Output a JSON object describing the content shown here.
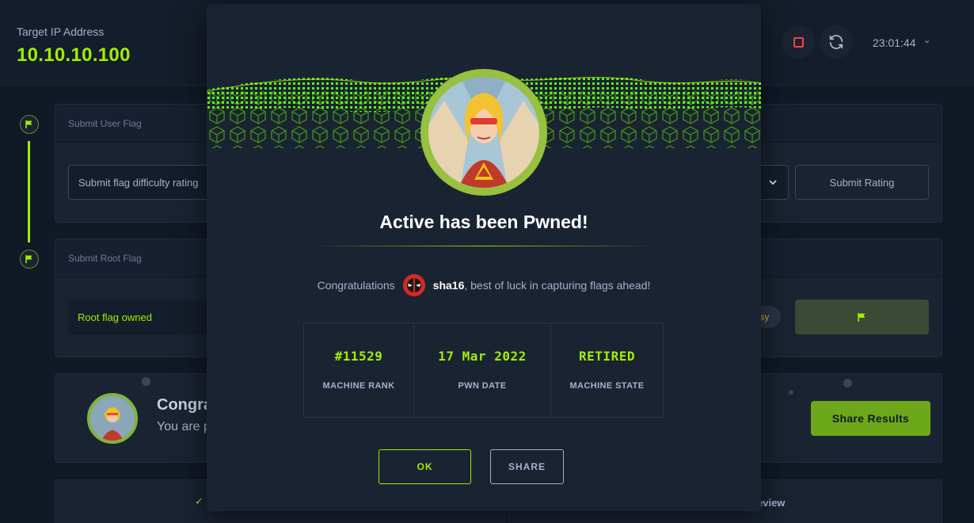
{
  "target": {
    "label": "Target IP Address",
    "ip": "10.10.10.100"
  },
  "controls": {
    "timer": "23:01:44",
    "stop_icon": "stop-icon",
    "reset_icon": "reset-icon"
  },
  "user_flag_card": {
    "title": "Submit User Flag",
    "rating_placeholder": "Submit flag difficulty rating",
    "submit_rating": "Submit Rating"
  },
  "root_flag_card": {
    "title": "Submit Root Flag",
    "owned_text": "Root flag owned",
    "difficulty_badge": "asy"
  },
  "background_congrats": {
    "title": "Congra",
    "subtitle": "You are p",
    "share_button": "Share Results"
  },
  "bottom": {
    "review_text": "eview"
  },
  "modal": {
    "title": "Active has been Pwned!",
    "congrats_prefix": "Congratulations",
    "username": "sha16",
    "congrats_suffix": ", best of luck in capturing flags ahead!",
    "stats": [
      {
        "value": "#11529",
        "label": "MACHINE RANK"
      },
      {
        "value": "17 Mar 2022",
        "label": "PWN DATE"
      },
      {
        "value": "RETIRED",
        "label": "MACHINE STATE"
      }
    ],
    "ok_button": "OK",
    "share_button": "SHARE"
  },
  "colors": {
    "accent": "#9fef00",
    "background": "#111927",
    "panel": "#1a2332",
    "danger": "#ff3e3e"
  }
}
